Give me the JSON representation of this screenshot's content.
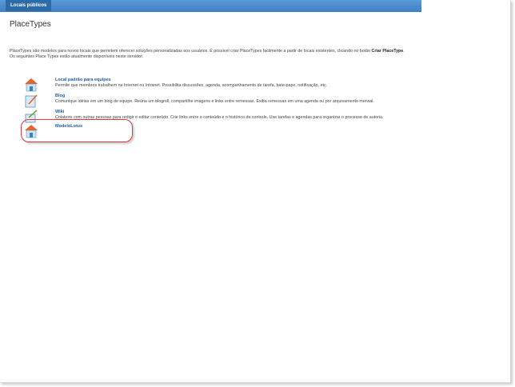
{
  "header": {
    "tab_label": "Locais públicos"
  },
  "page": {
    "title": "PlaceTypes",
    "intro_text": "PlaceTypes são modelos para novos locais que permitem oferecer soluções personalizadas aos usuários. É possível criar PlaceTypes facilmente a partir de locais existentes, clicando no botão ",
    "intro_bold": "Criar PlaceType",
    "intro_end": ".",
    "available_text": "Os seguintes Place Types estão atualmente disponíveis neste servidor."
  },
  "placetypes": [
    {
      "name": "Local padrão para equipes",
      "description": "Permite que membros trabalhem na Internet ou Intranet. Possibilita discussões, agenda, acompanhamento de tarefa, bate-papo, notificação, etc.",
      "icon": "house-icon"
    },
    {
      "name": "Blog",
      "description": "Comunique idéias em um blog de equipe. Reúna um blogroll, compartilhe imagens e links entre remessas. Exiba remessas em uma agenda ou por arquivamento mensal.",
      "icon": "blog-icon"
    },
    {
      "name": "Wiki",
      "description": "Colabore com outras pessoas para redigir e editar conteúdo. Crie links entre o conteúdo e o histórico de controle. Use tarefas e agendas para organizar o processo de autoria.",
      "icon": "wiki-icon"
    },
    {
      "name": "ModeloLotus",
      "description": "",
      "icon": "house-icon"
    }
  ],
  "colors": {
    "accent": "#1a5fb4",
    "highlight": "#e0383f",
    "header": "#3f7fc4"
  }
}
